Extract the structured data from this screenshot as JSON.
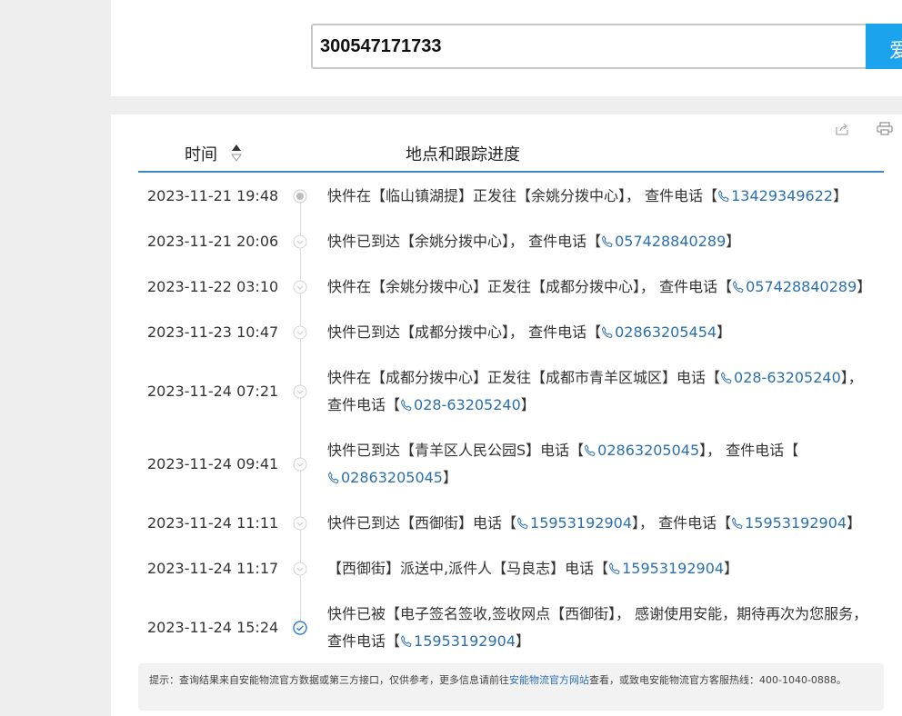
{
  "search": {
    "tracking_number": "300547171733",
    "button_label": "爱"
  },
  "table": {
    "col_time": "时间",
    "col_track": "地点和跟踪进度"
  },
  "rows": [
    {
      "time": "2023-11-21 19:48",
      "parts": [
        "快件在【临山镇湖提】正发往【余姚分拨中心】， 查件电话【",
        {
          "phone": "13429349622"
        },
        "】"
      ]
    },
    {
      "time": "2023-11-21 20:06",
      "parts": [
        "快件已到达【余姚分拨中心】， 查件电话【",
        {
          "phone": "057428840289"
        },
        "】"
      ]
    },
    {
      "time": "2023-11-22 03:10",
      "parts": [
        "快件在【余姚分拨中心】正发往【成都分拨中心】， 查件电话【",
        {
          "phone": "057428840289"
        },
        "】"
      ]
    },
    {
      "time": "2023-11-23 10:47",
      "parts": [
        "快件已到达【成都分拨中心】， 查件电话【",
        {
          "phone": "02863205454"
        },
        "】"
      ]
    },
    {
      "time": "2023-11-24 07:21",
      "parts": [
        "快件在【成都分拨中心】正发往【成都市青羊区城区】电话【",
        {
          "phone": "028-63205240"
        },
        "】， 查件电话【",
        {
          "phone": "028-63205240"
        },
        "】"
      ]
    },
    {
      "time": "2023-11-24 09:41",
      "parts": [
        "快件已到达【青羊区人民公园S】电话【",
        {
          "phone": "02863205045"
        },
        "】， 查件电话【",
        {
          "phone": "02863205045"
        },
        "】"
      ]
    },
    {
      "time": "2023-11-24 11:11",
      "parts": [
        "快件已到达【西御街】电话【",
        {
          "phone": "15953192904"
        },
        "】， 查件电话【",
        {
          "phone": "15953192904"
        },
        "】"
      ]
    },
    {
      "time": "2023-11-24 11:17",
      "parts": [
        "【西御街】派送中,派件人【马良志】电话【",
        {
          "phone": "15953192904"
        },
        "】"
      ]
    },
    {
      "time": "2023-11-24 15:24",
      "parts": [
        "快件已被【电子签名签收,签收网点【西御街】， 感谢使用安能，期待再次为您服务，查件电话【",
        {
          "phone": "15953192904"
        },
        "】"
      ]
    }
  ],
  "tip": {
    "prefix": "提示：查询结果来自安能物流官方数据或第三方接口，仅供参考，更多信息请前往",
    "link": "安能物流官方网站",
    "suffix": "查看，或致电安能物流官方客服热线：400-1040-0888。"
  },
  "colors": {
    "accent": "#1ba3ed",
    "link": "#2a6fb0",
    "header_rule": "#3c87c8"
  }
}
